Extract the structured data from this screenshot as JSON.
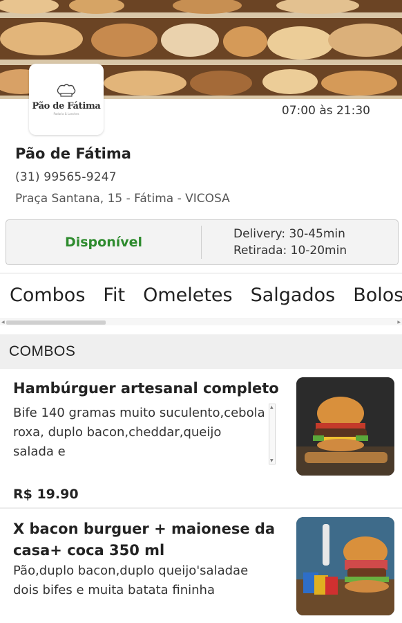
{
  "store": {
    "logo_text": "Pão de Fátima",
    "logo_sub": "Padaria & Lanches",
    "hours": "07:00 às 21:30",
    "name": "Pão de Fátima",
    "phone": "(31) 99565-9247",
    "address": "Praça Santana, 15 - Fátima - VICOSA"
  },
  "status": {
    "available": "Disponível",
    "delivery": "Delivery: 30-45min",
    "pickup": "Retirada: 10-20min",
    "available_color": "#2e8b2e"
  },
  "categories": [
    "Combos",
    "Fit",
    "Omeletes",
    "Salgados",
    "Bolos"
  ],
  "section": {
    "title": "COMBOS"
  },
  "items": [
    {
      "title": "Hambúrguer artesanal completo",
      "description": "Bife 140 gramas muito suculento,cebola roxa, duplo bacon,cheddar,queijo salada e",
      "price": "R$ 19.90",
      "image": "burger-photo"
    },
    {
      "title": "X bacon burguer + maionese da casa+ coca 350 ml",
      "description": "Pão,duplo bacon,duplo queijo'saladae dois bifes e muita batata fininha",
      "image": "burger-combo-photo"
    }
  ]
}
